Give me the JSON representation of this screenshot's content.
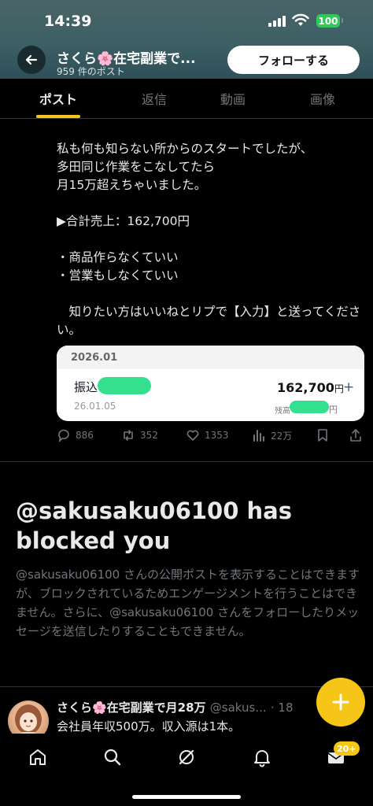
{
  "status_bar": {
    "time": "14:39",
    "battery": "100"
  },
  "header": {
    "profile_name": "さくら🌸在宅副業で...",
    "post_count": "959 件のポスト",
    "follow_label": "フォローする"
  },
  "tabs": [
    {
      "label": "ポスト"
    },
    {
      "label": "返信"
    },
    {
      "label": "動画"
    },
    {
      "label": "画像"
    }
  ],
  "post": {
    "line1": "私も何も知らない所からのスタートでしたが、\n多田同じ作業をこなしてたら\n月15万超えちゃいました。",
    "line2": "▶合計売上：162,700円",
    "line3": "・商品作らなくていい\n・営業もしなくていい",
    "line4": "　知りたい方はいいねとリプで【入力】と送ってください。",
    "card": {
      "month": "2026.01",
      "label": "振込",
      "date": "26.01.05",
      "amount": "162,700",
      "currency": "円",
      "plus": "+",
      "balance_label": "残高",
      "balance_yen": "円"
    },
    "stats": {
      "replies": "886",
      "reposts": "352",
      "likes": "1353",
      "views": "22万"
    }
  },
  "blocked": {
    "title": "@sakusaku06100 has blocked you",
    "description": "@sakusaku06100 さんの公開ポストを表示することはできますが、ブロックされているためエンゲージメントを行うことはできません。さらに、@sakusaku06100 さんをフォローしたりメッセージを送信したりすることもできません。"
  },
  "next_post": {
    "name": "さくら🌸在宅副業で月28万",
    "handle": "@sakus...",
    "time": "· 18",
    "text": "会社員年収500万。収入源は1本。"
  },
  "bottom_nav": {
    "badge": "20+"
  },
  "colors": {
    "accent": "#f5c518",
    "follow_bg": "#ffffff",
    "blur_green": "#34e08e"
  }
}
